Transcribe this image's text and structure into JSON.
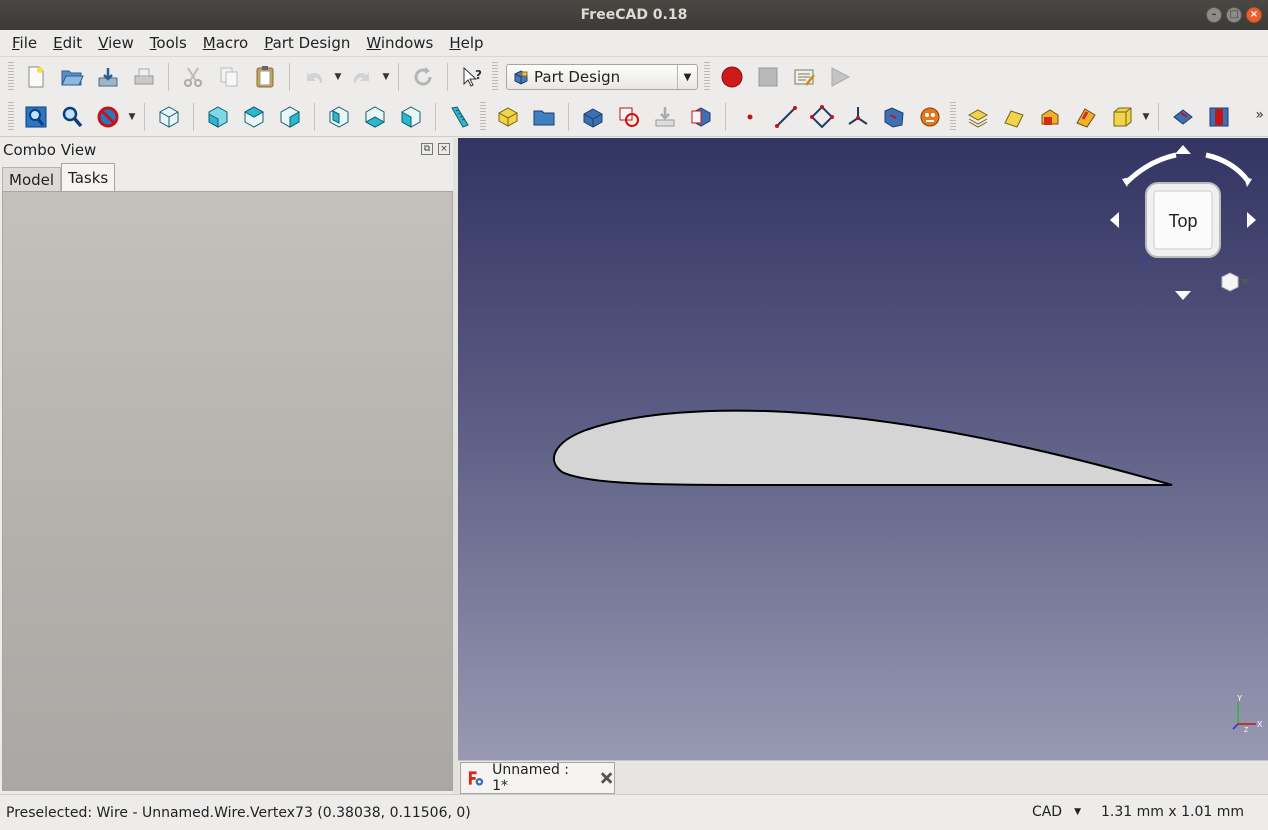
{
  "window": {
    "title": "FreeCAD 0.18"
  },
  "menu": [
    {
      "mn": "F",
      "rest": "ile"
    },
    {
      "mn": "E",
      "rest": "dit"
    },
    {
      "mn": "V",
      "rest": "iew"
    },
    {
      "mn": "T",
      "rest": "ools"
    },
    {
      "mn": "M",
      "rest": "acro"
    },
    {
      "mn": "P",
      "rest": "art Design"
    },
    {
      "mn": "W",
      "rest": "indows"
    },
    {
      "mn": "H",
      "rest": "elp"
    }
  ],
  "toolbar": {
    "workbench": "Part Design"
  },
  "combo": {
    "title": "Combo View",
    "tabs": [
      "Model",
      "Tasks"
    ],
    "active_tab": "Tasks"
  },
  "viewport": {
    "navcube_face": "Top",
    "axis_labels": {
      "x": "X",
      "y": "Y",
      "z": "Z"
    },
    "background_top": "#333462",
    "background_bottom": "#9899b2"
  },
  "document_tab": {
    "label": "Unnamed : 1*"
  },
  "status": {
    "message": "Preselected: Wire - Unnamed.Wire.Vertex73 (0.38038, 0.11506, 0)",
    "nav_style": "CAD",
    "dimensions": "1.31 mm x 1.01 mm"
  },
  "icons": [
    "new-icon",
    "open-icon",
    "save-icon",
    "print-icon",
    "cut-icon",
    "copy-icon",
    "paste-icon",
    "undo-icon",
    "redo-icon",
    "refresh-icon",
    "whats-this-icon",
    "macro-record-icon",
    "macro-stop-icon",
    "macro-edit-icon",
    "macro-run-icon",
    "fit-all-icon",
    "fit-selection-icon",
    "draw-style-icon",
    "isometric-icon",
    "front-view-icon",
    "top-view-icon",
    "right-view-icon",
    "rear-view-icon",
    "bottom-view-icon",
    "left-view-icon",
    "measure-icon",
    "body-icon",
    "part-icon",
    "pad-icon",
    "clone-icon",
    "shape-binder-icon",
    "sub-shape-binder-icon",
    "datum-point-icon",
    "datum-line-icon",
    "datum-plane-icon",
    "local-cs-icon",
    "sketch-icon",
    "create-sketch-icon",
    "pocket-loft-icon",
    "pipe-icon",
    "revolution-icon",
    "groove-icon",
    "additive-box-icon",
    "mirror-icon",
    "hole-icon"
  ]
}
